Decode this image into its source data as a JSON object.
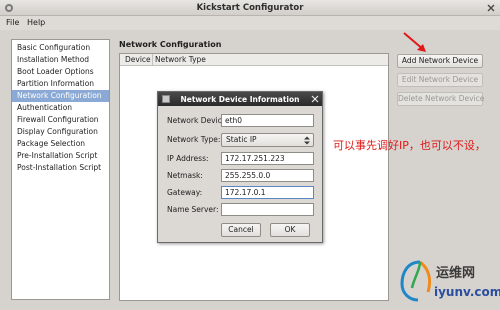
{
  "window": {
    "title": "Kickstart Configurator"
  },
  "menu": {
    "file": "File",
    "help": "Help"
  },
  "sidebar": {
    "items": [
      {
        "label": "Basic Configuration"
      },
      {
        "label": "Installation Method"
      },
      {
        "label": "Boot Loader Options"
      },
      {
        "label": "Partition Information"
      },
      {
        "label": "Network Configuration",
        "selected": true
      },
      {
        "label": "Authentication"
      },
      {
        "label": "Firewall Configuration"
      },
      {
        "label": "Display Configuration"
      },
      {
        "label": "Package Selection"
      },
      {
        "label": "Pre-Installation Script"
      },
      {
        "label": "Post-Installation Script"
      }
    ],
    "selected_color": "#8aa9d4"
  },
  "main": {
    "title": "Network Configuration",
    "table": {
      "columns": [
        "Device",
        "Network Type"
      ]
    },
    "buttons": {
      "add": "Add Network Device",
      "edit": "Edit Network Device",
      "delete": "Delete Network Device"
    }
  },
  "dialog": {
    "title": "Network Device Information",
    "fields": {
      "device_label": "Network Device:",
      "device_value": "eth0",
      "type_label": "Network Type:",
      "type_value": "Static IP",
      "ip_label": "IP Address:",
      "ip_value": "172.17.251.223",
      "netmask_label": "Netmask:",
      "netmask_value": "255.255.0.0",
      "gateway_label": "Gateway:",
      "gateway_value": "172.17.0.1",
      "nameserver_label": "Name Server:",
      "nameserver_value": ""
    },
    "cancel": "Cancel",
    "ok": "OK"
  },
  "annotation": {
    "text": "可以事先调好IP，也可以不设，",
    "color": "#e01818"
  },
  "watermark": {
    "cn": "运维网",
    "url": "iyunv.com"
  }
}
